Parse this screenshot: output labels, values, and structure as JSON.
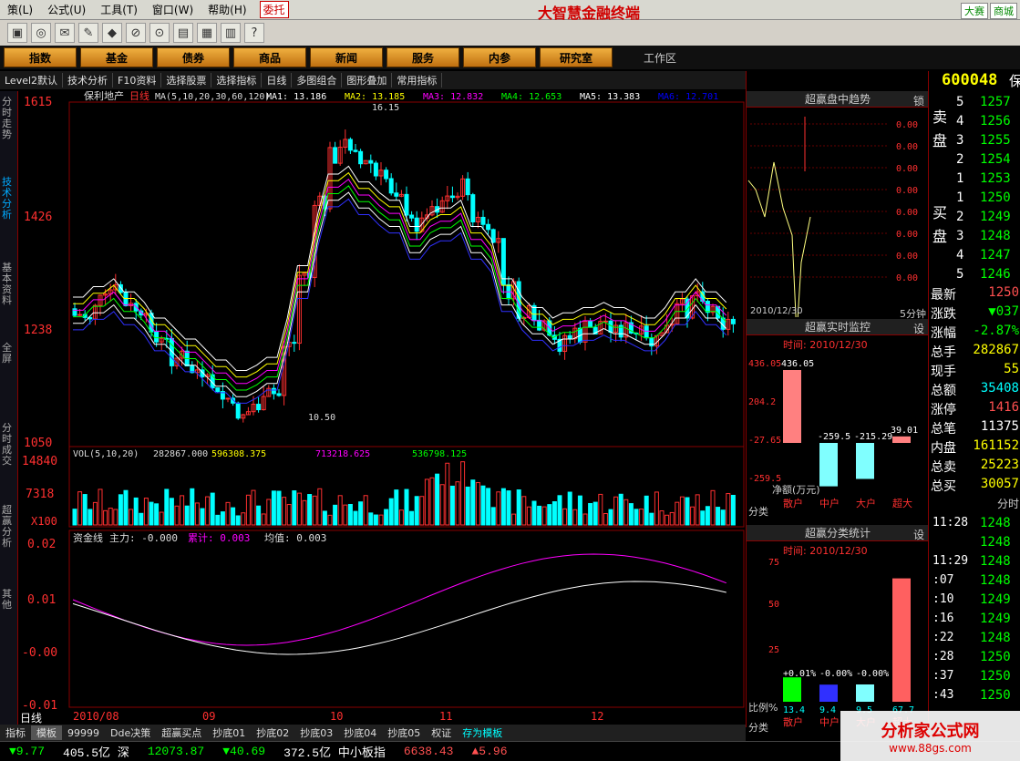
{
  "menubar": {
    "items": [
      "策(L)",
      "公式(U)",
      "工具(T)",
      "窗口(W)",
      "帮助(H)"
    ],
    "trade": "委托",
    "app_title": "大智慧金融终端",
    "btn_dasai": "大赛",
    "btn_shangcheng": "商城"
  },
  "navbar": {
    "items": [
      "指数",
      "基金",
      "债券",
      "商品",
      "新闻",
      "服务",
      "内参",
      "研究室"
    ],
    "workspace": "工作区"
  },
  "tabbar": {
    "items": [
      "Level2默认",
      "技术分析",
      "F10资料",
      "选择股票",
      "选择指标",
      "日线",
      "多图组合",
      "图形叠加",
      "常用指标"
    ]
  },
  "sidetabs": [
    "分时走势",
    "技术分析",
    "基本资料",
    "全屏",
    "分时成交",
    "超赢分析",
    "其他"
  ],
  "kline": {
    "stock_name": "保利地产",
    "period": "日线",
    "ma_label": "MA(5,10,20,30,60,120)",
    "ma_values": [
      {
        "name": "MA1",
        "value": "13.186",
        "color": "#ffffff"
      },
      {
        "name": "MA2",
        "value": "13.185",
        "color": "#ffff00"
      },
      {
        "name": "MA3",
        "value": "12.832",
        "color": "#ff00ff"
      },
      {
        "name": "MA4",
        "value": "12.653",
        "color": "#00ff00"
      },
      {
        "name": "MA5",
        "value": "13.383",
        "color": "#ffffff"
      },
      {
        "name": "MA6",
        "value": "12.701",
        "color": "#0000ff"
      }
    ],
    "y_ticks": [
      "1615",
      "1426",
      "1238",
      "1050"
    ],
    "high_label": "16.15",
    "low_label": "10.50"
  },
  "volume": {
    "label": "VOL(5,10,20)",
    "vol": "282867.000",
    "ma1": "596308.375",
    "ma2": "713218.625",
    "ma3": "536798.125",
    "y_ticks": [
      "14840",
      "7318",
      "X100"
    ]
  },
  "capital": {
    "label": "资金线",
    "main": "主力: -0.000",
    "cum": "累计: 0.003",
    "avg": "均值: 0.003",
    "y_ticks": [
      "0.02",
      "0.01",
      "-0.00",
      "-0.01"
    ]
  },
  "xaxis": {
    "labels": [
      "2010/08",
      "09",
      "10",
      "11",
      "12"
    ]
  },
  "period_badge": "日线",
  "rightpanel": {
    "trend_title": "超赢盘中趋势",
    "lock": "锁",
    "trend_ticks": [
      "0.00",
      "0.00",
      "0.00",
      "0.00",
      "0.00",
      "0.00",
      "0.00",
      "0.00"
    ],
    "trend_date": "2010/12/30",
    "trend_period": "5分钟",
    "monitor_title": "超赢实时监控",
    "monitor_btn": "设",
    "monitor_time": "时间: 2010/12/30",
    "monitor_axis": [
      "436.05",
      "204.2",
      "-27.65",
      "-259.5"
    ],
    "monitor_label": "净额(万元)",
    "monitor_values": [
      {
        "cat": "散户",
        "value": "436.05"
      },
      {
        "cat": "中户",
        "value": "-259.5"
      },
      {
        "cat": "大户",
        "value": "-215.29"
      },
      {
        "cat": "超大",
        "value": "39.01"
      }
    ],
    "fenlei": "分类",
    "stat_title": "超赢分类统计",
    "stat_btn": "设",
    "stat_time": "时间: 2010/12/30",
    "stat_axis": [
      "75",
      "50",
      "25"
    ],
    "stat_values": [
      {
        "cat": "散户",
        "pct": "+0.01%",
        "value": "13.4"
      },
      {
        "cat": "中户",
        "pct": "-0.00%",
        "value": "9.4"
      },
      {
        "cat": "大户",
        "pct": "-0.00%",
        "value": "9.5"
      },
      {
        "cat": "超大",
        "pct": "",
        "value": "67.7"
      }
    ],
    "stat_ratio_label": "比例%"
  },
  "quote": {
    "code": "600048",
    "name": "保",
    "sell": [
      {
        "lvl": "5",
        "price": "1257"
      },
      {
        "lvl": "4",
        "price": "1256"
      },
      {
        "lvl": "3",
        "price": "1255"
      },
      {
        "lvl": "2",
        "price": "1254"
      },
      {
        "lvl": "1",
        "price": "1253"
      }
    ],
    "buy": [
      {
        "lvl": "1",
        "price": "1250"
      },
      {
        "lvl": "2",
        "price": "1249"
      },
      {
        "lvl": "3",
        "price": "1248"
      },
      {
        "lvl": "4",
        "price": "1247"
      },
      {
        "lvl": "5",
        "price": "1246"
      }
    ],
    "sell_label": "卖盘",
    "buy_label": "买盘",
    "stats": [
      {
        "k": "最新",
        "v": "1250"
      },
      {
        "k": "涨跌",
        "v": "▼037"
      },
      {
        "k": "涨幅",
        "v": "-2.87%"
      },
      {
        "k": "总手",
        "v": "282867"
      },
      {
        "k": "现手",
        "v": "55"
      },
      {
        "k": "总额",
        "v": "35408"
      },
      {
        "k": "涨停",
        "v": "1416"
      },
      {
        "k": "总笔",
        "v": "11375"
      },
      {
        "k": "内盘",
        "v": "161152"
      },
      {
        "k": "总卖",
        "v": "25223"
      },
      {
        "k": "总买",
        "v": "30057"
      }
    ],
    "ticks_title": "分时",
    "ticks": [
      {
        "t": "11:28",
        "p": "1248"
      },
      {
        "t": "",
        "p": "1248"
      },
      {
        "t": "11:29",
        "p": "1248"
      },
      {
        "t": ":07",
        "p": "1248"
      },
      {
        "t": ":10",
        "p": "1249"
      },
      {
        "t": ":16",
        "p": "1249"
      },
      {
        "t": ":22",
        "p": "1248"
      },
      {
        "t": ":28",
        "p": "1250"
      },
      {
        "t": ":37",
        "p": "1250"
      },
      {
        "t": ":43",
        "p": "1250"
      }
    ]
  },
  "bottombar": {
    "items": [
      "指标",
      "模板",
      "99999",
      "Dde决策",
      "超赢买点",
      "抄底01",
      "抄底02",
      "抄底03",
      "抄底04",
      "抄底05",
      "权证",
      "存为模板"
    ]
  },
  "statusbar": {
    "items": [
      {
        "v": "▼9.77",
        "c": "#00ff00"
      },
      {
        "v": "405.5亿 深",
        "c": "#ffffff"
      },
      {
        "v": "12073.87",
        "c": "#00ff00"
      },
      {
        "v": "▼40.69",
        "c": "#00ff00"
      },
      {
        "v": "372.5亿 中小板指",
        "c": "#ffffff"
      },
      {
        "v": "6638.43",
        "c": "#ff5050"
      },
      {
        "v": "▲5.96",
        "c": "#ff5050"
      }
    ]
  },
  "watermark": {
    "line1": "分析家公式网",
    "line2": "www.88gs.com"
  }
}
